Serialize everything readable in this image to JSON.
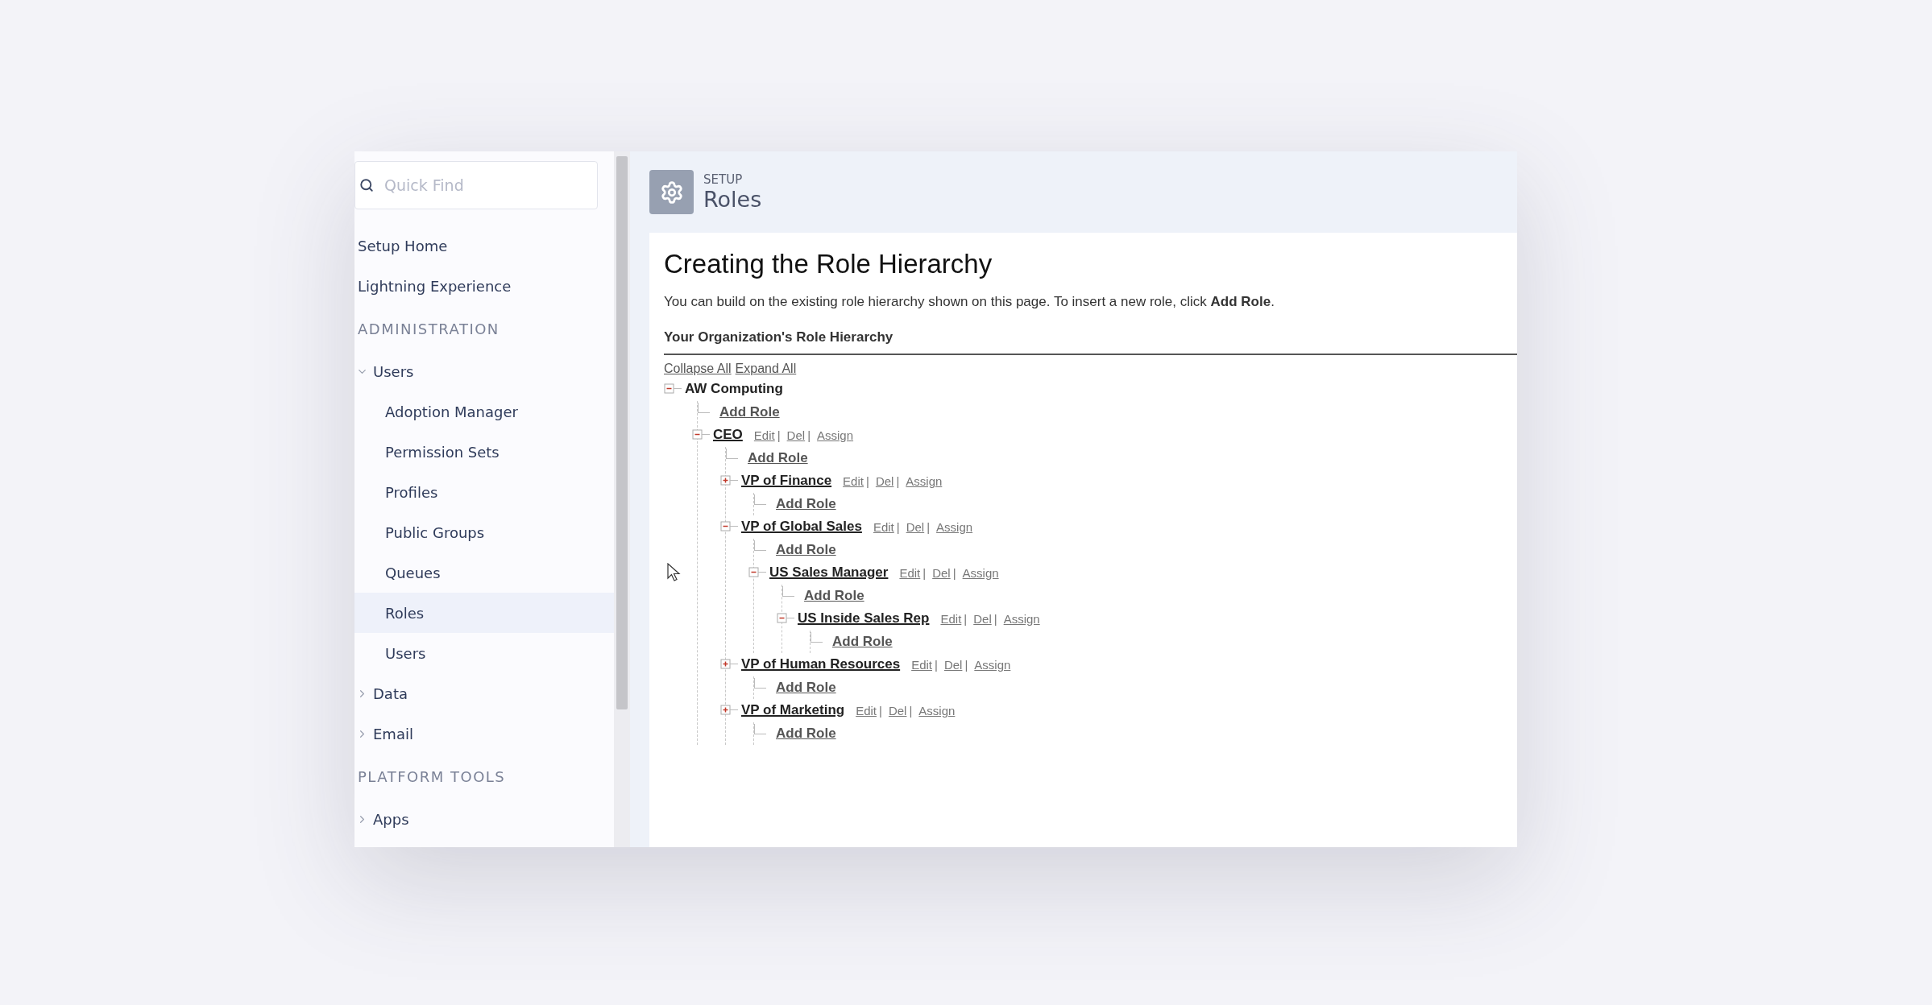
{
  "sidebar": {
    "search": {
      "placeholder": "Quick Find"
    },
    "items": [
      {
        "label": "Setup Home",
        "kind": "link"
      },
      {
        "label": "Lightning Experience",
        "kind": "link"
      },
      {
        "label": "ADMINISTRATION",
        "kind": "heading"
      },
      {
        "label": "Users",
        "kind": "group",
        "expanded": true,
        "children": [
          {
            "label": "Adoption Manager",
            "selected": false
          },
          {
            "label": "Permission Sets",
            "selected": false
          },
          {
            "label": "Profiles",
            "selected": false
          },
          {
            "label": "Public Groups",
            "selected": false
          },
          {
            "label": "Queues",
            "selected": false
          },
          {
            "label": "Roles",
            "selected": true
          },
          {
            "label": "Users",
            "selected": false
          }
        ]
      },
      {
        "label": "Data",
        "kind": "group",
        "expanded": false
      },
      {
        "label": "Email",
        "kind": "group",
        "expanded": false
      },
      {
        "label": "PLATFORM TOOLS",
        "kind": "heading"
      },
      {
        "label": "Apps",
        "kind": "group",
        "expanded": false
      }
    ]
  },
  "header": {
    "eyebrow": "SETUP",
    "title": "Roles"
  },
  "content": {
    "title": "Creating the Role Hierarchy",
    "intro": "You can build on the existing role hierarchy shown on this page. To insert a new role, click **Add Role**.",
    "section_title": "Your Organization's Role Hierarchy",
    "tree_links": [
      "Collapse All",
      "Expand All"
    ],
    "action_separator": "|",
    "tree": {
      "name": "AW Computing",
      "link": false,
      "expanded": true,
      "add_role": "Add Role",
      "children": [
        {
          "name": "CEO",
          "link": true,
          "expanded": true,
          "actions": [
            "Edit",
            "Del",
            "Assign"
          ],
          "add_role": "Add Role",
          "children": [
            {
              "name": "VP of Finance",
              "link": true,
              "expanded": false,
              "actions": [
                "Edit",
                "Del",
                "Assign"
              ],
              "add_role": "Add Role"
            },
            {
              "name": "VP of Global Sales",
              "link": true,
              "expanded": true,
              "actions": [
                "Edit",
                "Del",
                "Assign"
              ],
              "add_role": "Add Role",
              "children": [
                {
                  "name": "US Sales Manager",
                  "link": true,
                  "expanded": true,
                  "actions": [
                    "Edit",
                    "Del",
                    "Assign"
                  ],
                  "add_role": "Add Role",
                  "children": [
                    {
                      "name": "US Inside Sales Rep",
                      "link": true,
                      "expanded": true,
                      "actions": [
                        "Edit",
                        "Del",
                        "Assign"
                      ],
                      "add_role": "Add Role"
                    }
                  ]
                }
              ]
            },
            {
              "name": "VP of Human Resources",
              "link": true,
              "expanded": false,
              "actions": [
                "Edit",
                "Del",
                "Assign"
              ],
              "add_role": "Add Role"
            },
            {
              "name": "VP of Marketing",
              "link": true,
              "expanded": false,
              "actions": [
                "Edit",
                "Del",
                "Assign"
              ],
              "add_role": "Add Role"
            }
          ]
        }
      ]
    }
  }
}
